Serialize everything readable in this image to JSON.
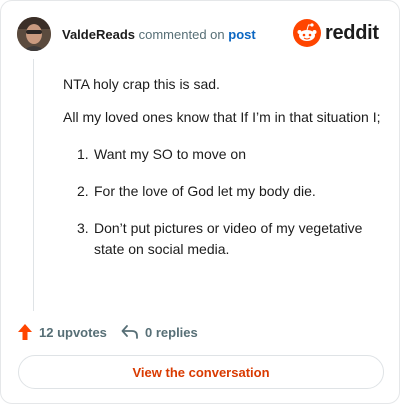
{
  "header": {
    "username": "ValdeReads",
    "action_text": "commented on",
    "post_link": "post",
    "logo_text": "reddit"
  },
  "comment": {
    "paragraphs": [
      "NTA holy crap this is sad.",
      "All my loved ones know that If I’m in that situation I;"
    ],
    "list_items": [
      {
        "num": "1.",
        "text": "Want my SO to move on"
      },
      {
        "num": "2.",
        "text": "For the love of God let my body die."
      },
      {
        "num": "3.",
        "text": "Don’t put pictures or video of my vegetative state on social media."
      }
    ]
  },
  "actions": {
    "upvotes_label": "12 upvotes",
    "replies_label": "0 replies"
  },
  "cta": {
    "label": "View the conversation"
  },
  "colors": {
    "brand": "#ff4500",
    "link": "#0a66c2",
    "cta_text": "#d93a00",
    "muted": "#576f76"
  },
  "icons": [
    "avatar",
    "reddit-snoo-icon",
    "upvote-arrow-icon",
    "reply-arrow-icon"
  ]
}
